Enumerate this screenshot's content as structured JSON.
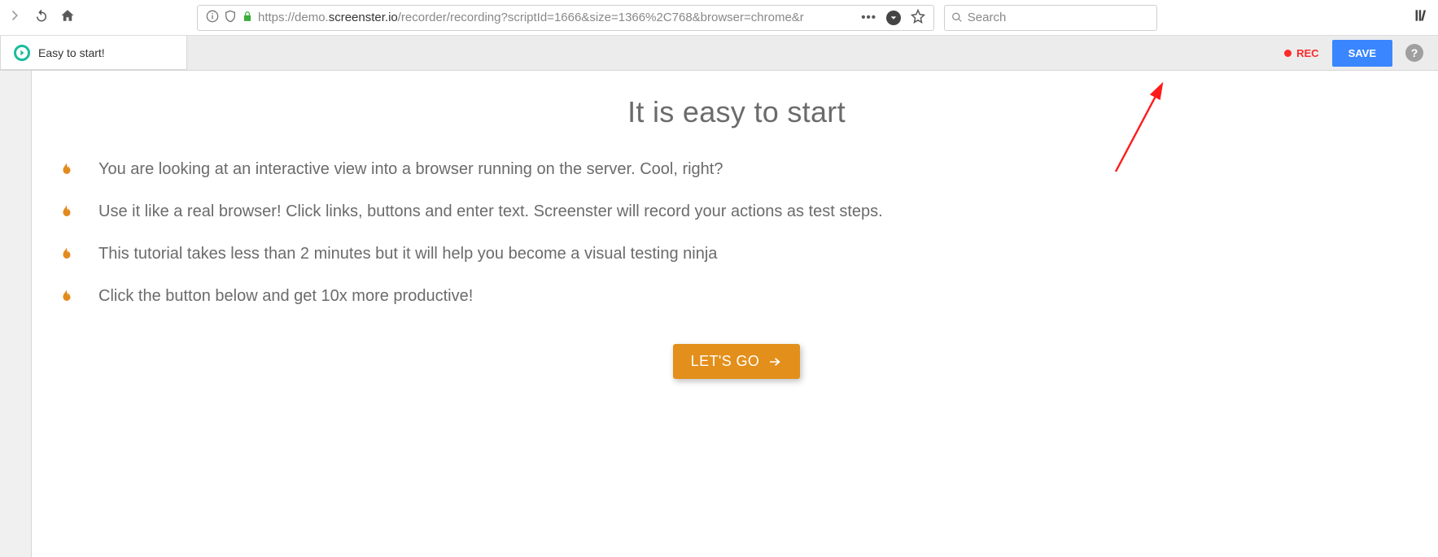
{
  "browser": {
    "url_prefix": "https://demo.",
    "url_host": "screenster.io",
    "url_path": "/recorder/recording?scriptId=1666&size=1366%2C768&browser=chrome&r",
    "search_placeholder": "Search"
  },
  "toolbar": {
    "tab_label": "Easy to start!",
    "rec_label": "REC",
    "save_label": "SAVE"
  },
  "page": {
    "title": "It is easy to start",
    "bullets": [
      "You are looking at an interactive view into a browser running on the server. Cool, right?",
      "Use it like a real browser! Click links, buttons and enter text. Screenster will record your actions as test steps.",
      "This tutorial takes less than 2 minutes but it will help you become a visual testing ninja",
      "Click the button below and get 10x more productive!"
    ],
    "cta_label": "LET'S GO"
  }
}
